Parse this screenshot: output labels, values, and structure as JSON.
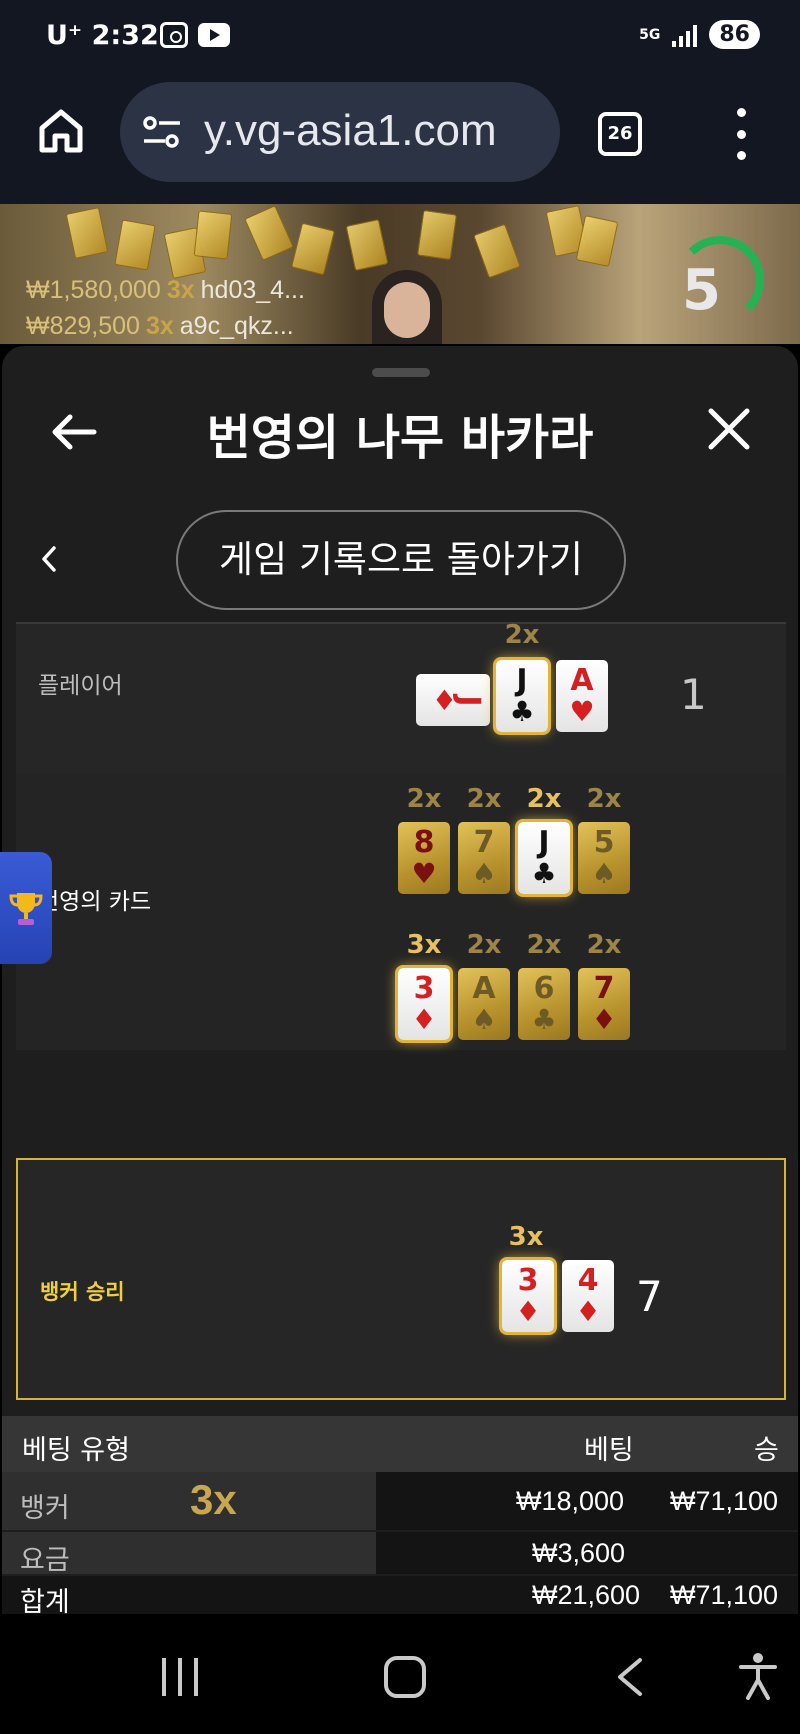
{
  "status_bar": {
    "carrier": "U⁺",
    "time": "2:32",
    "network": "5G",
    "battery": "86"
  },
  "browser": {
    "url": "y.vg-asia1.com",
    "tab_count": "26"
  },
  "stream": {
    "bets": [
      {
        "amount": "₩1,580,000",
        "multiplier": "3x",
        "user": "hd03_4..."
      },
      {
        "amount": "₩829,500",
        "multiplier": "3x",
        "user": "a9c_qkz..."
      }
    ],
    "countdown": "5"
  },
  "panel": {
    "title": "번영의 나무 바카라",
    "history_button": "게임 기록으로 돌아가기",
    "player": {
      "label": "플레이어",
      "multiplier": "2x",
      "total": "1",
      "cards": [
        {
          "rank": "J",
          "suit": "♦",
          "color": "red",
          "orientation": "sideways"
        },
        {
          "rank": "J",
          "suit": "♣",
          "color": "black",
          "style": "white-glow"
        },
        {
          "rank": "A",
          "suit": "♥",
          "color": "red",
          "style": "white"
        }
      ]
    },
    "prosperity": {
      "label": "번영의 카드",
      "row1": [
        {
          "mult": "2x",
          "rank": "8",
          "suit": "♥",
          "color": "red",
          "style": "gold"
        },
        {
          "mult": "2x",
          "rank": "7",
          "suit": "♠",
          "color": "black",
          "style": "gold"
        },
        {
          "mult": "2x",
          "rank": "J",
          "suit": "♣",
          "color": "black",
          "style": "white-glow",
          "highlight": true
        },
        {
          "mult": "2x",
          "rank": "5",
          "suit": "♠",
          "color": "black",
          "style": "gold"
        }
      ],
      "row2": [
        {
          "mult": "3x",
          "rank": "3",
          "suit": "♦",
          "color": "red",
          "style": "white-glow",
          "highlight": true
        },
        {
          "mult": "2x",
          "rank": "A",
          "suit": "♠",
          "color": "black",
          "style": "gold"
        },
        {
          "mult": "2x",
          "rank": "6",
          "suit": "♣",
          "color": "black",
          "style": "gold"
        },
        {
          "mult": "2x",
          "rank": "7",
          "suit": "♦",
          "color": "red",
          "style": "gold"
        }
      ]
    },
    "banker": {
      "label": "뱅커 승리",
      "multiplier": "3x",
      "total": "7",
      "cards": [
        {
          "rank": "3",
          "suit": "♦",
          "color": "red",
          "style": "white-glow"
        },
        {
          "rank": "4",
          "suit": "♦",
          "color": "red",
          "style": "white"
        }
      ]
    },
    "bet_table": {
      "headers": {
        "type": "베팅 유형",
        "bet": "베팅",
        "win": "승"
      },
      "rows": [
        {
          "type": "뱅커",
          "multiplier": "3x",
          "bet": "₩18,000",
          "win": "₩71,100"
        },
        {
          "type": "요금",
          "bet": "₩3,600",
          "win": ""
        },
        {
          "type": "합계",
          "bet": "₩21,600",
          "win": "₩71,100"
        }
      ]
    }
  },
  "colors": {
    "panel_bg": "#1e1e1e",
    "section_bg": "#262626",
    "banker_border": "#d8b62c",
    "banker_text": "#f0cf3c",
    "timer": "#24b255",
    "gold_multiplier": "#e8c062"
  }
}
